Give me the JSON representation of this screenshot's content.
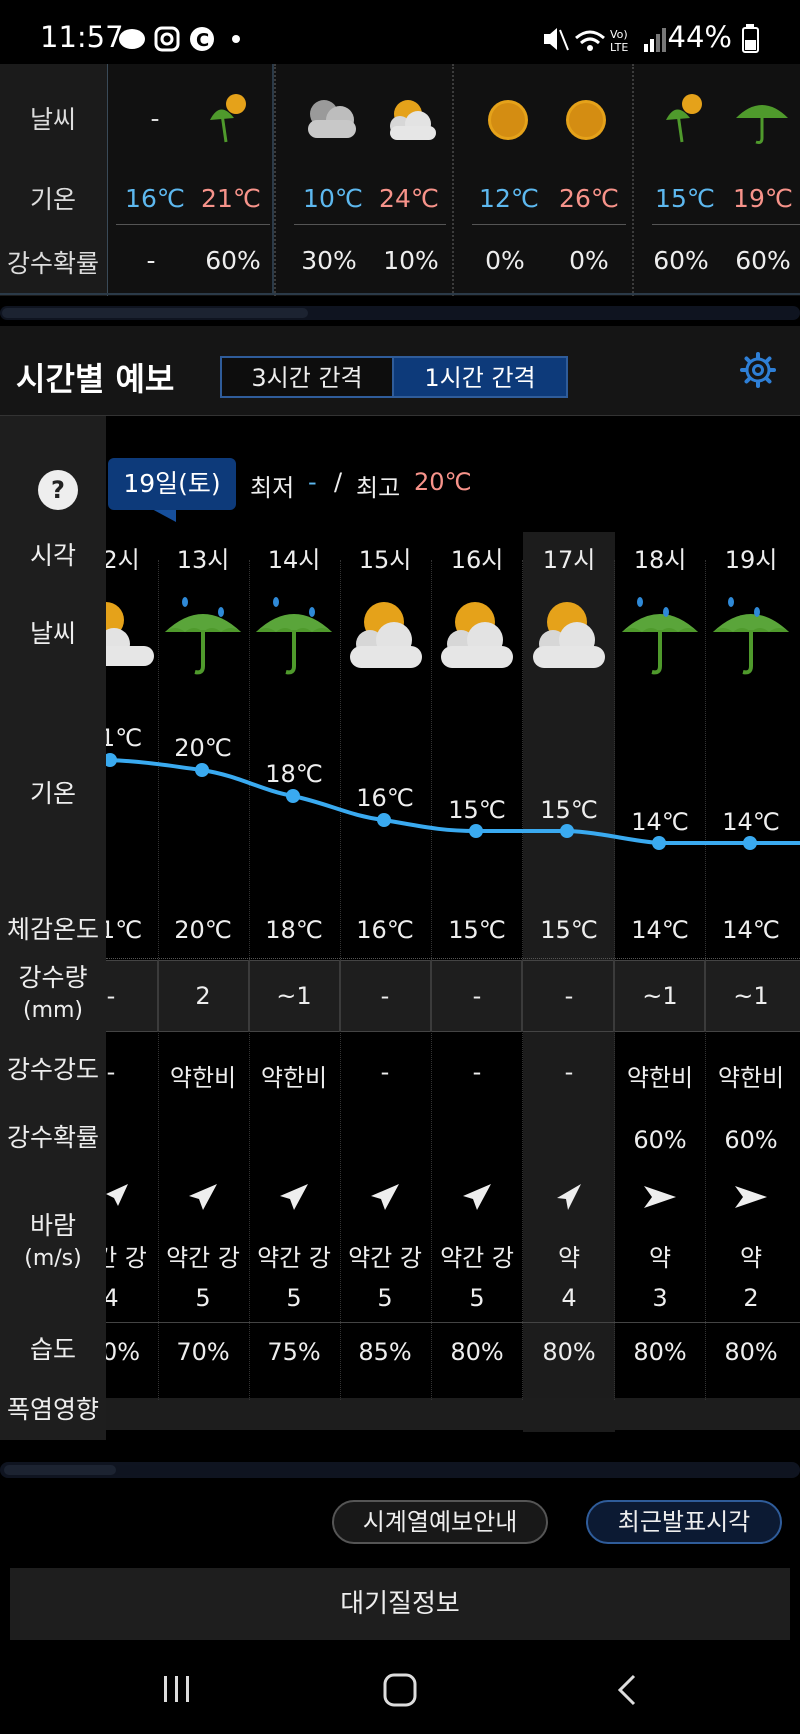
{
  "status_bar": {
    "time": "11:57",
    "battery": "44%"
  },
  "daily": {
    "labels": {
      "weather": "날씨",
      "temp": "기온",
      "precip_prob": "강수확률"
    },
    "cells": [
      {
        "min": "16℃",
        "max": "21℃",
        "prob_am": "-",
        "prob_pm": "60%",
        "weather_am": "-",
        "weather_pm": "rain-sun-icon"
      },
      {
        "min": "10℃",
        "max": "24℃",
        "prob_am": "30%",
        "prob_pm": "10%",
        "weather_am": "cloudy-icon",
        "weather_pm": "partly-cloudy-icon"
      },
      {
        "min": "12℃",
        "max": "26℃",
        "prob_am": "0%",
        "prob_pm": "0%",
        "weather_am": "sun-icon",
        "weather_pm": "sun-icon"
      },
      {
        "min": "15℃",
        "max": "19℃",
        "prob_am": "60%",
        "prob_pm": "60%",
        "weather_am": "rain-sun-icon",
        "weather_pm": "umbrella-icon"
      }
    ]
  },
  "hourly": {
    "title": "시간별 예보",
    "tabs": {
      "three_hour": "3시간 간격",
      "one_hour": "1시간 간격"
    },
    "help": "?",
    "date": "19일(토)",
    "min_label": "최저",
    "min_value": "-",
    "slash": "/",
    "max_label": "최고",
    "max_value": "20℃",
    "row_labels": {
      "time": "시각",
      "weather": "날씨",
      "temp": "기온",
      "feels": "체감온도",
      "rain_amount": "강수량",
      "rain_unit": "(mm)",
      "rain_intensity": "강수강도",
      "rain_prob": "강수확률",
      "wind": "바람",
      "wind_unit": "(m/s)",
      "humidity": "습도",
      "heat": "폭염영향"
    },
    "partial_col": {
      "time": "2시",
      "temp": "1℃",
      "feels": "1℃",
      "rain": "-",
      "intensity": "-",
      "wind_text": "간 강",
      "wind_speed": "4",
      "humidity": "0%"
    },
    "columns": [
      {
        "time": "13시",
        "icon": "umbrella-icon",
        "temp": "20℃",
        "feels": "20℃",
        "rain": "2",
        "intensity": "약한비",
        "prob": "",
        "wind_text": "약간 강",
        "wind_speed": "5",
        "humidity": "70%"
      },
      {
        "time": "14시",
        "icon": "umbrella-icon",
        "temp": "18℃",
        "feels": "18℃",
        "rain": "~1",
        "intensity": "약한비",
        "prob": "",
        "wind_text": "약간 강",
        "wind_speed": "5",
        "humidity": "75%"
      },
      {
        "time": "15시",
        "icon": "partly-cloudy-icon",
        "temp": "16℃",
        "feels": "16℃",
        "rain": "-",
        "intensity": "-",
        "prob": "",
        "wind_text": "약간 강",
        "wind_speed": "5",
        "humidity": "85%"
      },
      {
        "time": "16시",
        "icon": "partly-cloudy-icon",
        "temp": "15℃",
        "feels": "15℃",
        "rain": "-",
        "intensity": "-",
        "prob": "",
        "wind_text": "약간 강",
        "wind_speed": "5",
        "humidity": "80%"
      },
      {
        "time": "17시",
        "icon": "partly-cloudy-icon",
        "temp": "15℃",
        "feels": "15℃",
        "rain": "-",
        "intensity": "-",
        "prob": "",
        "wind_text": "약",
        "wind_speed": "4",
        "humidity": "80%"
      },
      {
        "time": "18시",
        "icon": "umbrella-icon",
        "temp": "14℃",
        "feels": "14℃",
        "rain": "~1",
        "intensity": "약한비",
        "prob": "60%",
        "wind_text": "약",
        "wind_speed": "3",
        "humidity": "80%"
      },
      {
        "time": "19시",
        "icon": "umbrella-icon",
        "temp": "14℃",
        "feels": "14℃",
        "rain": "~1",
        "intensity": "약한비",
        "prob": "60%",
        "wind_text": "약",
        "wind_speed": "2",
        "humidity": "80%"
      }
    ]
  },
  "buttons": {
    "forecast_guide": "시계열예보안내",
    "latest_time": "최근발표시각",
    "air_quality": "대기질정보"
  },
  "colors": {
    "accent": "#0d3a7a",
    "line": "#3aaaf0",
    "low": "#5db8ef",
    "high": "#f7938a"
  }
}
